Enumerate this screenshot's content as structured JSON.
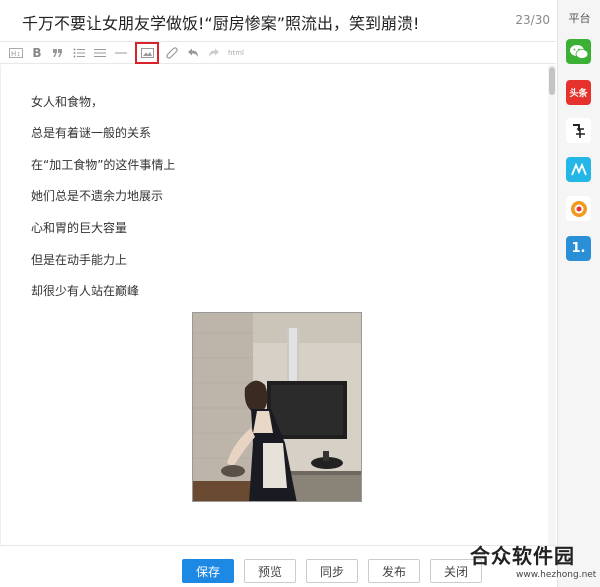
{
  "article": {
    "title": "千万不要让女朋友学做饭!“厨房惨案”照流出，笑到崩溃!",
    "title_count": "23/30"
  },
  "toolbar": {
    "items": [
      {
        "name": "heading",
        "icon": "heading-icon"
      },
      {
        "name": "bold",
        "icon": "bold-icon",
        "label": "B"
      },
      {
        "name": "quote",
        "icon": "quote-icon"
      },
      {
        "name": "ordered-list",
        "icon": "ordered-list-icon"
      },
      {
        "name": "unordered-list",
        "icon": "unordered-list-icon"
      },
      {
        "name": "horizontal-rule",
        "icon": "horizontal-rule-icon"
      },
      {
        "name": "insert-image",
        "icon": "image-icon",
        "highlighted": true
      },
      {
        "name": "link",
        "icon": "link-icon"
      },
      {
        "name": "undo",
        "icon": "undo-icon"
      },
      {
        "name": "redo",
        "icon": "redo-icon"
      },
      {
        "name": "html",
        "icon": "html-icon",
        "label": "html"
      }
    ],
    "highlight_color": "#d9232a"
  },
  "content": {
    "paragraphs": [
      "女人和食物，",
      "总是有着谜一般的关系",
      "在“加工食物”的这件事情上",
      "她们总是不遗余力地展示",
      "心和胃的巨大容量",
      "但是在动手能力上",
      "却很少有人站在巅峰"
    ]
  },
  "footer": {
    "save": "保存",
    "preview": "预览",
    "sync": "同步",
    "publish": "发布",
    "close": "关闭",
    "primary_color": "#1e88e5"
  },
  "platform": {
    "title": "平台",
    "items": [
      {
        "name": "wechat",
        "icon": "wechat-icon",
        "color": "#3cb034"
      },
      {
        "name": "toutiao",
        "icon": "toutiao-icon",
        "label": "头条",
        "color": "#e5322d"
      },
      {
        "name": "baijia",
        "icon": "baijia-icon",
        "color": "#ffffff"
      },
      {
        "name": "qiehao",
        "icon": "qiehao-icon",
        "color": "#23b6e6"
      },
      {
        "name": "sohu",
        "icon": "sohu-icon",
        "color": "#ffffff"
      },
      {
        "name": "yidian",
        "icon": "yidian-icon",
        "label": "1.",
        "color": "#2a8fd6"
      }
    ]
  },
  "watermark": {
    "title": "合众软件园",
    "url": "www.hezhong.net"
  }
}
